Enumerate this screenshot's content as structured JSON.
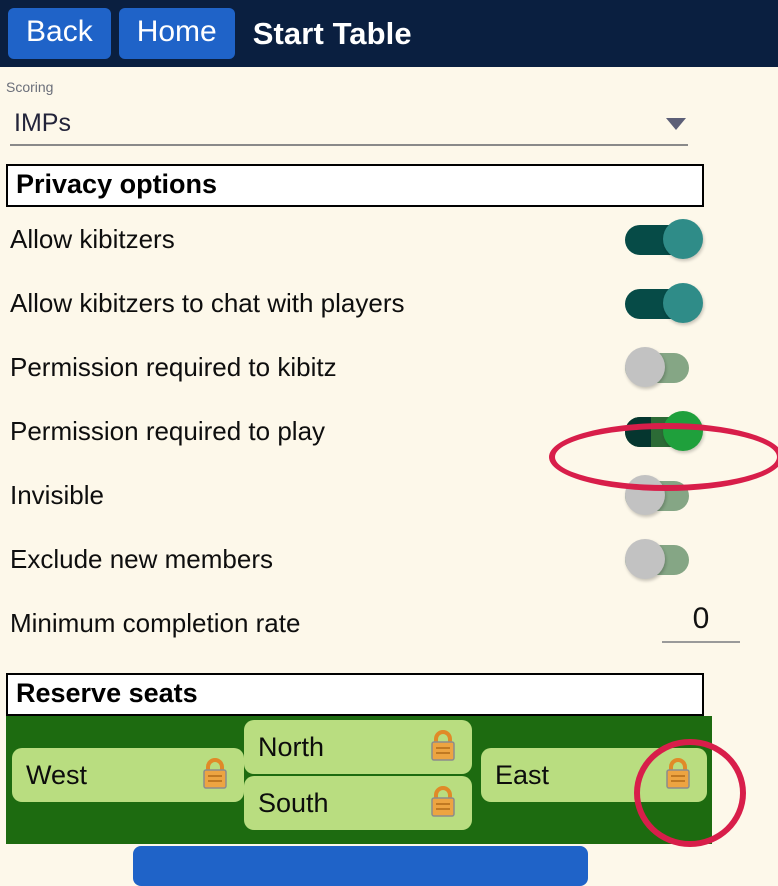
{
  "header": {
    "back_label": "Back",
    "home_label": "Home",
    "title": "Start Table",
    "button_color": "#1f63c8",
    "bar_color": "#0a1f40"
  },
  "scoring": {
    "label": "Scoring",
    "value": "IMPs",
    "caret_icon": "chevron-down-icon"
  },
  "privacy": {
    "section_title": "Privacy options",
    "options": [
      {
        "label": "Allow kibitzers",
        "state": "on",
        "control": "toggle"
      },
      {
        "label": "Allow kibitzers to chat with players",
        "state": "on",
        "control": "toggle"
      },
      {
        "label": "Permission required to kibitz",
        "state": "off",
        "control": "toggle"
      },
      {
        "label": "Permission required to play",
        "state": "on",
        "control": "toggle",
        "highlighted": true
      },
      {
        "label": "Invisible",
        "state": "off",
        "control": "toggle"
      },
      {
        "label": "Exclude new members",
        "state": "off",
        "control": "toggle"
      }
    ],
    "completion": {
      "label": "Minimum completion rate",
      "value": "0"
    }
  },
  "reserve": {
    "section_title": "Reserve seats",
    "panel_color": "#1d6b10",
    "tile_color": "#b9dd80",
    "seats": [
      {
        "name": "West",
        "lock_icon": "lock-icon"
      },
      {
        "name": "North",
        "lock_icon": "lock-icon"
      },
      {
        "name": "South",
        "lock_icon": "lock-icon"
      },
      {
        "name": "East",
        "lock_icon": "lock-icon",
        "highlighted": true
      }
    ]
  },
  "annotations": {
    "color": "#d81e4a",
    "shapes": [
      {
        "target": "permission-required-to-play-toggle",
        "shape": "ellipse"
      },
      {
        "target": "seat-east-lock-icon",
        "shape": "ellipse"
      }
    ]
  },
  "toggle_colors": {
    "on_track": "#064b47",
    "on_thumb": "#2f8c88",
    "green_track": "#2c6b36",
    "green_thumb": "#1fa03c",
    "off_track": "#85a685",
    "off_thumb": "#c2c2c2"
  }
}
